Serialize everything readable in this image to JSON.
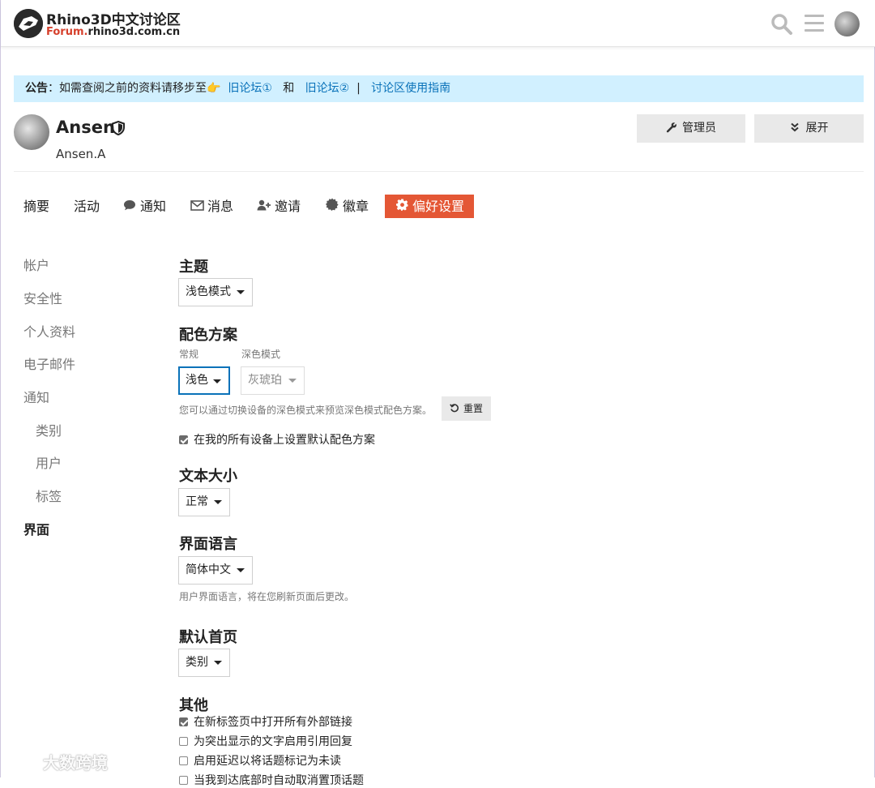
{
  "header": {
    "site_title": "Rhino3D中文讨论区",
    "site_sub_prefix": "Forum.",
    "site_sub_rest": "rhino3d.com.cn"
  },
  "notice": {
    "label": "公告",
    "text": "：如需查阅之前的资料请移步至👉",
    "link1": "旧论坛①",
    "and": "和",
    "link2": "旧论坛②",
    "sep": "|",
    "link3": "讨论区使用指南"
  },
  "user": {
    "name": "Ansen",
    "handle": "Ansen.A",
    "admin_button": "管理员",
    "expand_button": "展开"
  },
  "tabs": {
    "summary": "摘要",
    "activity": "活动",
    "notifications": "通知",
    "messages": "消息",
    "invites": "邀请",
    "badges": "徽章",
    "preferences": "偏好设置"
  },
  "sidebar": {
    "account": "帐户",
    "security": "安全性",
    "profile": "个人资料",
    "email": "电子邮件",
    "notifications": "通知",
    "categories": "类别",
    "users": "用户",
    "tags": "标签",
    "interface": "界面"
  },
  "content": {
    "theme_title": "主题",
    "theme_value": "浅色模式",
    "scheme_title": "配色方案",
    "scheme_regular_label": "常规",
    "scheme_dark_label": "深色模式",
    "scheme_regular_value": "浅色",
    "scheme_dark_value": "灰琥珀",
    "scheme_hint": "您可以通过切换设备的深色模式来预览深色模式配色方案。",
    "reset_button": "重置",
    "scheme_default_all": "在我的所有设备上设置默认配色方案",
    "text_size_title": "文本大小",
    "text_size_value": "正常",
    "language_title": "界面语言",
    "language_value": "简体中文",
    "language_hint": "用户界面语言，将在您刷新页面后更改。",
    "homepage_title": "默认首页",
    "homepage_value": "类别",
    "other_title": "其他",
    "other_opt1": "在新标签页中打开所有外部链接",
    "other_opt2": "为突出显示的文字启用引用回复",
    "other_opt3": "启用延迟以将话题标记为未读",
    "other_opt4": "当我到达底部时自动取消置顶话题"
  },
  "checkbox_states": {
    "scheme_default_all": true,
    "other_opt1": true,
    "other_opt2": false,
    "other_opt3": false,
    "other_opt4": false
  },
  "watermark": "大数跨境",
  "colors": {
    "accent": "#e45735",
    "link": "#0a72b9",
    "notice_bg": "#d1f0ff",
    "button_bg": "#e9e9e9"
  }
}
